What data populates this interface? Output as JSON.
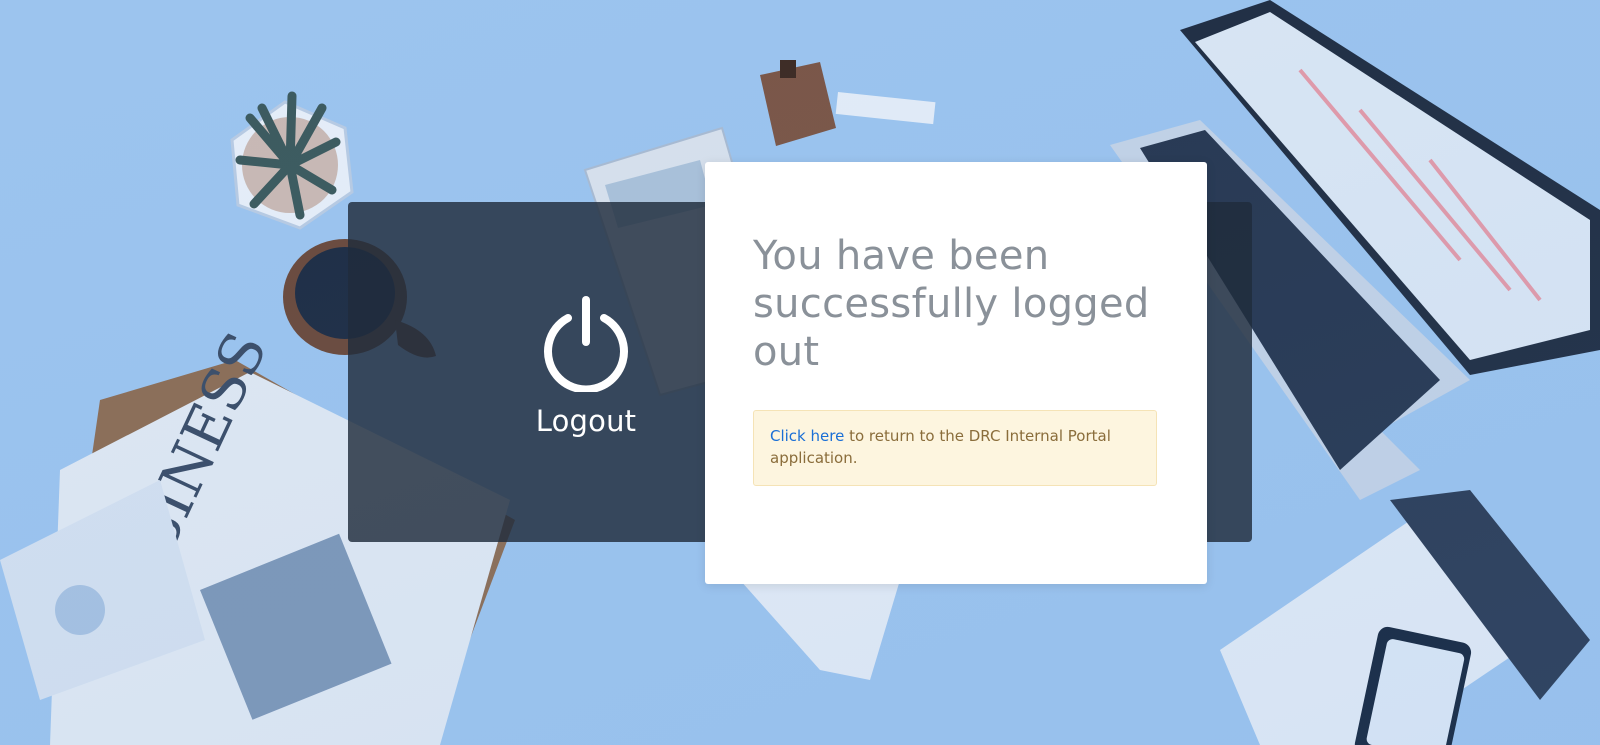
{
  "logout_panel": {
    "label": "Logout",
    "icon": "power-icon"
  },
  "card": {
    "title": "You have been successfully logged out",
    "alert": {
      "link_text": "Click here",
      "message": " to return to the DRC Internal Portal application."
    }
  },
  "colors": {
    "panel": "#202c3c",
    "card": "#ffffff",
    "title": "#8a9199",
    "alert_bg": "#fdf5df",
    "alert_text": "#8a6d3b",
    "link": "#1a6fd6",
    "background": "#9cc4ee"
  }
}
